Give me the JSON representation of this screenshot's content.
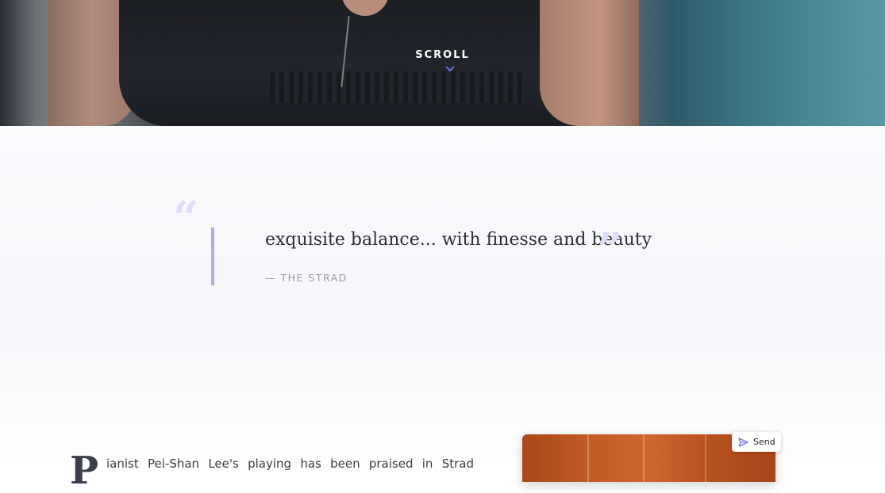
{
  "hero": {
    "scroll_label": "SCROLL"
  },
  "quote": {
    "open_mark": "“",
    "close_mark": "”",
    "text": "exquisite balance... with finesse and beauty",
    "source": "— THE STRAD"
  },
  "bio": {
    "dropcap": "P",
    "text": "ianist Pei-Shan Lee's playing has been praised in Strad"
  },
  "send_button": {
    "label": "Send",
    "icon": "send-icon"
  },
  "colors": {
    "accent": "#a7b0ee",
    "quote_marks": "#dcdff7",
    "chevron": "#6b73e0",
    "album": "#c25a24"
  }
}
